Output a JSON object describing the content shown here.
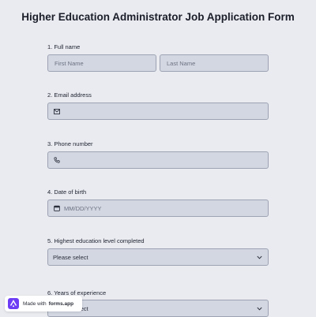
{
  "form": {
    "title": "Higher Education Administrator Job Application Form"
  },
  "questions": {
    "q1": {
      "label": "1.  Full name",
      "first_placeholder": "First Name",
      "last_placeholder": "Last Name"
    },
    "q2": {
      "label": "2. Email address",
      "icon": "envelope-icon"
    },
    "q3": {
      "label": "3. Phone number",
      "icon": "phone-icon"
    },
    "q4": {
      "label": "4. Date of birth",
      "icon": "calendar-icon",
      "placeholder": "MM/DD/YYYY"
    },
    "q5": {
      "label": "5. Highest education level completed",
      "selected": "Please select"
    },
    "q6": {
      "label": "6. Years of experience",
      "selected": "Please select"
    }
  },
  "badge": {
    "prefix": "Made with",
    "brand": "forms.app",
    "logo_color": "#6c3df4"
  },
  "colors": {
    "page_bg": "#e9ebf0",
    "field_bg": "#d3d7e2",
    "field_border": "#9da3b3"
  }
}
